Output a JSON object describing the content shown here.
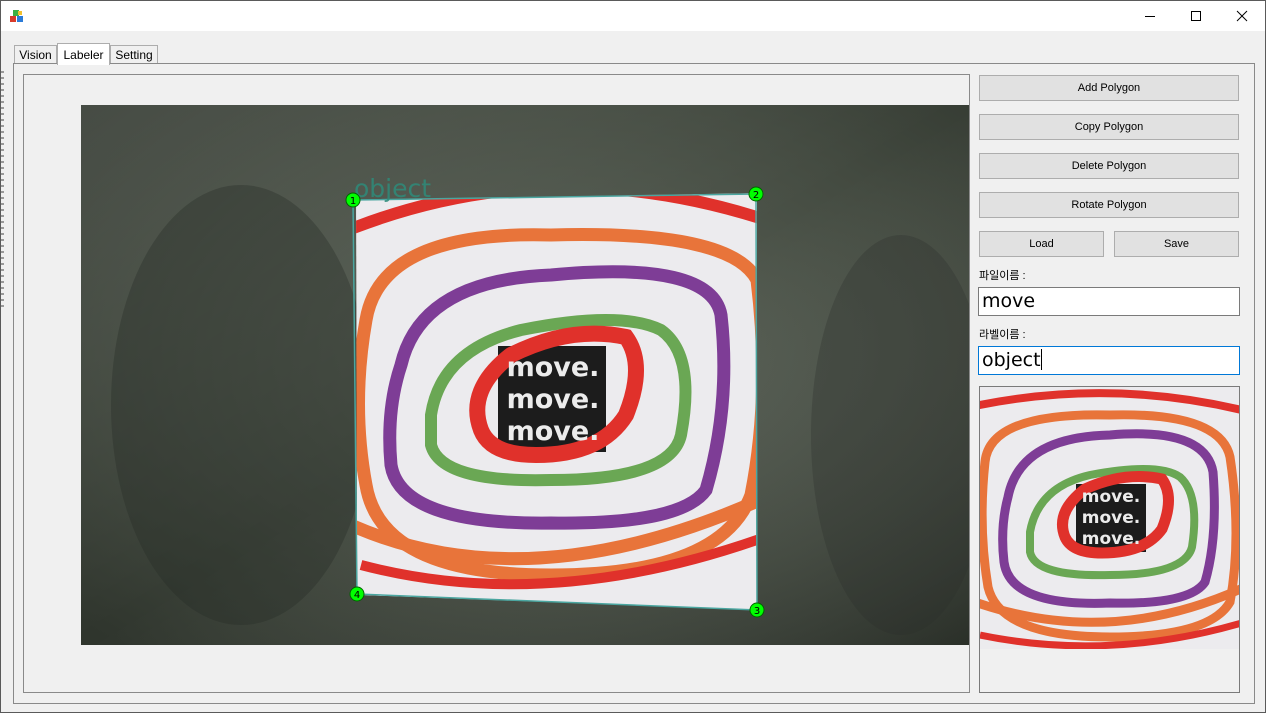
{
  "window": {
    "minimize_glyph": "—",
    "maximize_glyph": "☐",
    "close_glyph": "✕"
  },
  "tabs": [
    {
      "label": "Vision",
      "active": false
    },
    {
      "label": "Labeler",
      "active": true
    },
    {
      "label": "Setting",
      "active": false
    }
  ],
  "canvas": {
    "label_text": "object",
    "label_color": "#2e8b7a",
    "polygon_color": "#4aa6a0",
    "vertex_color": "#00ff00",
    "vertices": [
      "1",
      "2",
      "3",
      "4"
    ],
    "poster_text": [
      "move.",
      "move.",
      "move."
    ]
  },
  "buttons": {
    "add_polygon": "Add Polygon",
    "copy_polygon": "Copy Polygon",
    "delete_polygon": "Delete Polygon",
    "rotate_polygon": "Rotate Polygon",
    "load": "Load",
    "save": "Save"
  },
  "fields": {
    "file_name_label": "파일이름 :",
    "file_name_value": "move",
    "label_name_label": "라벨이름 :",
    "label_name_value": "object"
  },
  "preview": {
    "poster_text": [
      "move.",
      "move.",
      "move."
    ]
  },
  "colors": {
    "ring_red": "#e0312b",
    "ring_orange": "#e8743a",
    "ring_purple": "#7e3d96",
    "ring_green": "#6aa754",
    "background_leather": "#4b5148"
  }
}
